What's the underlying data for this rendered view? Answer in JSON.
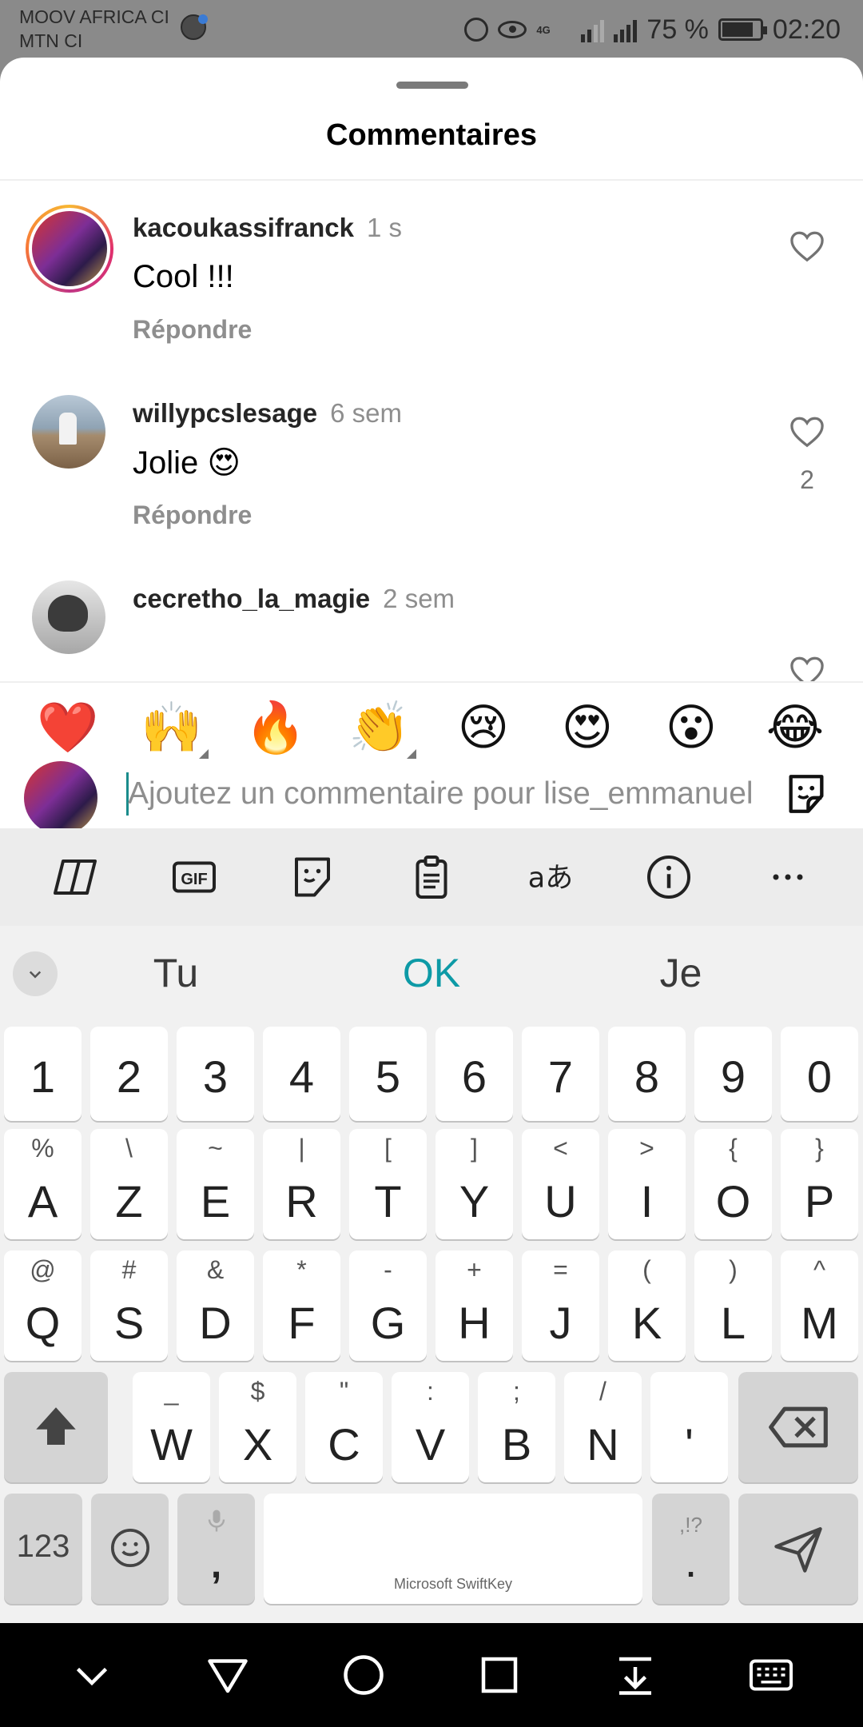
{
  "status_bar": {
    "carrier_1": "MOOV AFRICA CI",
    "carrier_2": "MTN CI",
    "network": "4G",
    "battery": "75 %",
    "time": "02:20"
  },
  "sheet": {
    "title": "Commentaires"
  },
  "comments": [
    {
      "username": "kacoukassifranck",
      "time": "1 s",
      "text": "Cool !!!",
      "reply": "Répondre",
      "likes": ""
    },
    {
      "username": "willypcslesage",
      "time": "6 sem",
      "text": "Jolie 😍",
      "reply": "Répondre",
      "likes": "2"
    },
    {
      "username": "cecretho_la_magie",
      "time": "2 sem",
      "text": "",
      "reply": "",
      "likes": ""
    }
  ],
  "quick_reactions": [
    "❤️",
    "🙌",
    "🔥",
    "👏",
    "😢",
    "😍",
    "😮",
    "😂"
  ],
  "comment_input": {
    "placeholder": "Ajoutez un commentaire pour lise_emmanuel"
  },
  "keyboard": {
    "toolbar": [
      "copilot-icon",
      "gif-icon",
      "sticker-icon",
      "clipboard-icon",
      "translate-icon",
      "info-icon",
      "more-icon"
    ],
    "gif_label": "GIF",
    "translate_label": "aあ",
    "suggestions": [
      "Tu",
      "OK",
      "Je"
    ],
    "number_row": [
      "1",
      "2",
      "3",
      "4",
      "5",
      "6",
      "7",
      "8",
      "9",
      "0"
    ],
    "row1": [
      {
        "main": "A",
        "sub": "%"
      },
      {
        "main": "Z",
        "sub": "\\"
      },
      {
        "main": "E",
        "sub": "~"
      },
      {
        "main": "R",
        "sub": "|"
      },
      {
        "main": "T",
        "sub": "["
      },
      {
        "main": "Y",
        "sub": "]"
      },
      {
        "main": "U",
        "sub": "<"
      },
      {
        "main": "I",
        "sub": ">"
      },
      {
        "main": "O",
        "sub": "{"
      },
      {
        "main": "P",
        "sub": "}"
      }
    ],
    "row2": [
      {
        "main": "Q",
        "sub": "@"
      },
      {
        "main": "S",
        "sub": "#"
      },
      {
        "main": "D",
        "sub": "&"
      },
      {
        "main": "F",
        "sub": "*"
      },
      {
        "main": "G",
        "sub": "-"
      },
      {
        "main": "H",
        "sub": "+"
      },
      {
        "main": "J",
        "sub": "="
      },
      {
        "main": "K",
        "sub": "("
      },
      {
        "main": "L",
        "sub": ")"
      },
      {
        "main": "M",
        "sub": "^"
      }
    ],
    "row3": [
      {
        "main": "W",
        "sub": "_"
      },
      {
        "main": "X",
        "sub": "$"
      },
      {
        "main": "C",
        "sub": "\""
      },
      {
        "main": "V",
        "sub": ":"
      },
      {
        "main": "B",
        "sub": ";"
      },
      {
        "main": "N",
        "sub": "/"
      },
      {
        "main": "'",
        "sub": ""
      }
    ],
    "numbers_key": "123",
    "comma_key": ",",
    "period_key": ".",
    "period_sub": ",!?",
    "space_label": "Microsoft SwiftKey"
  },
  "nav_bar": [
    "chevron-down-icon",
    "back-triangle-icon",
    "home-circle-icon",
    "recents-square-icon",
    "download-icon",
    "keyboard-icon"
  ]
}
